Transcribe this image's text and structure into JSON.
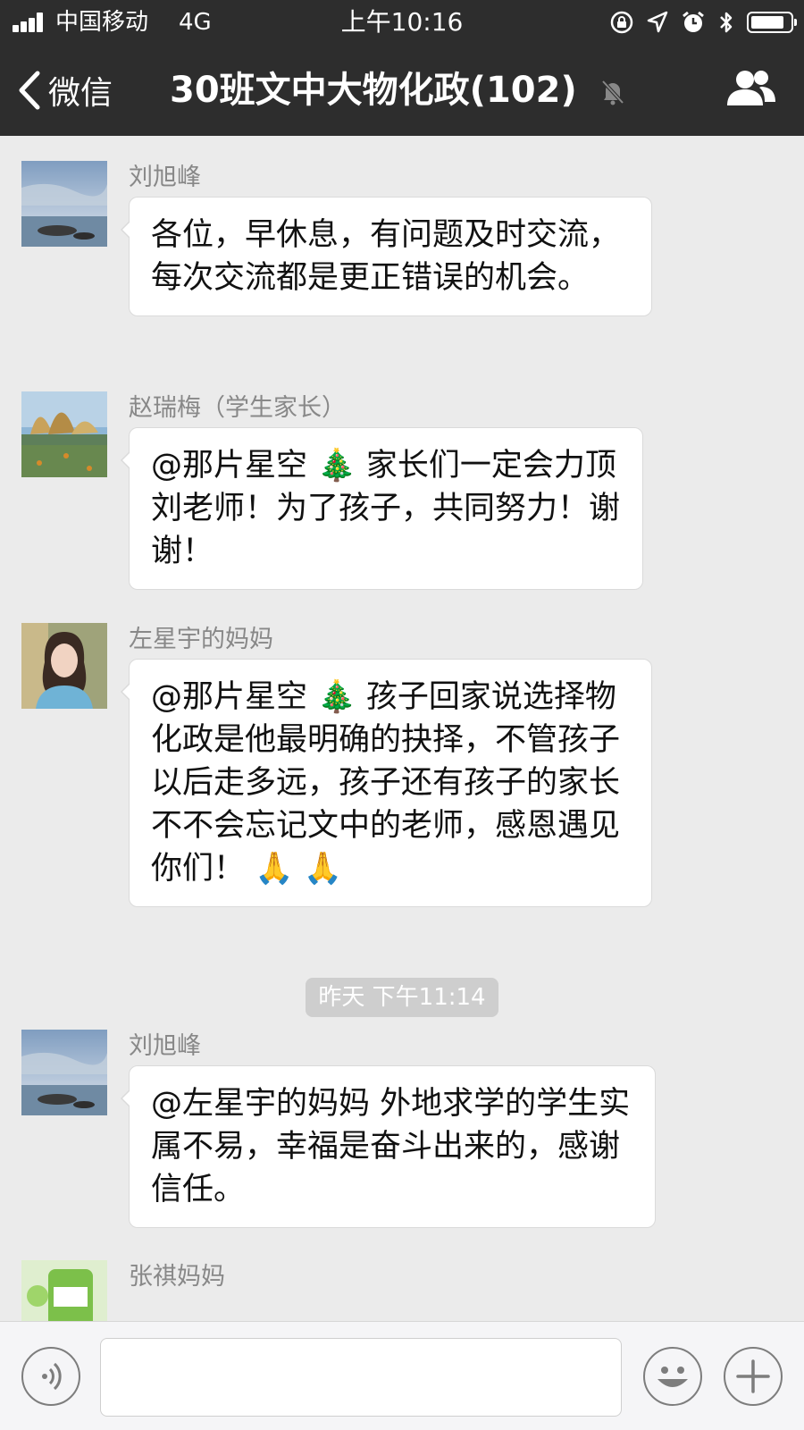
{
  "status_bar": {
    "carrier": "中国移动",
    "network": "4G",
    "time": "上午10:16"
  },
  "nav": {
    "back_label": "微信",
    "title": "30班文中大物化政(102)"
  },
  "messages": [
    {
      "sender": "刘旭峰",
      "text": "各位，早休息，有问题及时交流，每次交流都是更正错误的机会。",
      "avatar": "lake-avatar"
    },
    {
      "sender": "赵瑞梅（学生家长）",
      "text": "@那片星空 🎄 家长们一定会力顶刘老师！为了孩子，共同努力！谢谢！",
      "avatar": "autumn-pond-avatar"
    },
    {
      "sender": "左星宇的妈妈",
      "text": "@那片星空 🎄 孩子回家说选择物化政是他最明确的抉择，不管孩子以后走多远，孩子还有孩子的家长不不会忘记文中的老师，感恩遇见你们！ 🙏 🙏",
      "avatar": "woman-portrait-avatar"
    },
    {
      "sender": "刘旭峰",
      "text": "@左星宇的妈妈 外地求学的学生实属不易，幸福是奋斗出来的，感谢信任。",
      "avatar": "lake-avatar"
    },
    {
      "sender": "张祺妈妈",
      "avatar": "green-product-avatar"
    }
  ],
  "timestamp": "昨天 下午11:14",
  "input": {
    "value": "",
    "placeholder": ""
  },
  "icons": {
    "signal": "signal-icon",
    "rotation_lock": "rotation-lock-icon",
    "location": "location-icon",
    "alarm": "alarm-icon",
    "bluetooth": "bluetooth-icon",
    "battery": "battery-icon",
    "back": "chevron-left-icon",
    "mute": "bell-mute-icon",
    "members": "people-icon",
    "voice": "voice-icon",
    "emoji": "emoji-icon",
    "plus": "plus-icon"
  },
  "colors": {
    "nav_background": "#2d2d2d",
    "chat_background": "#ebebeb",
    "bubble": "#ffffff",
    "timestamp_badge": "#cecece"
  }
}
